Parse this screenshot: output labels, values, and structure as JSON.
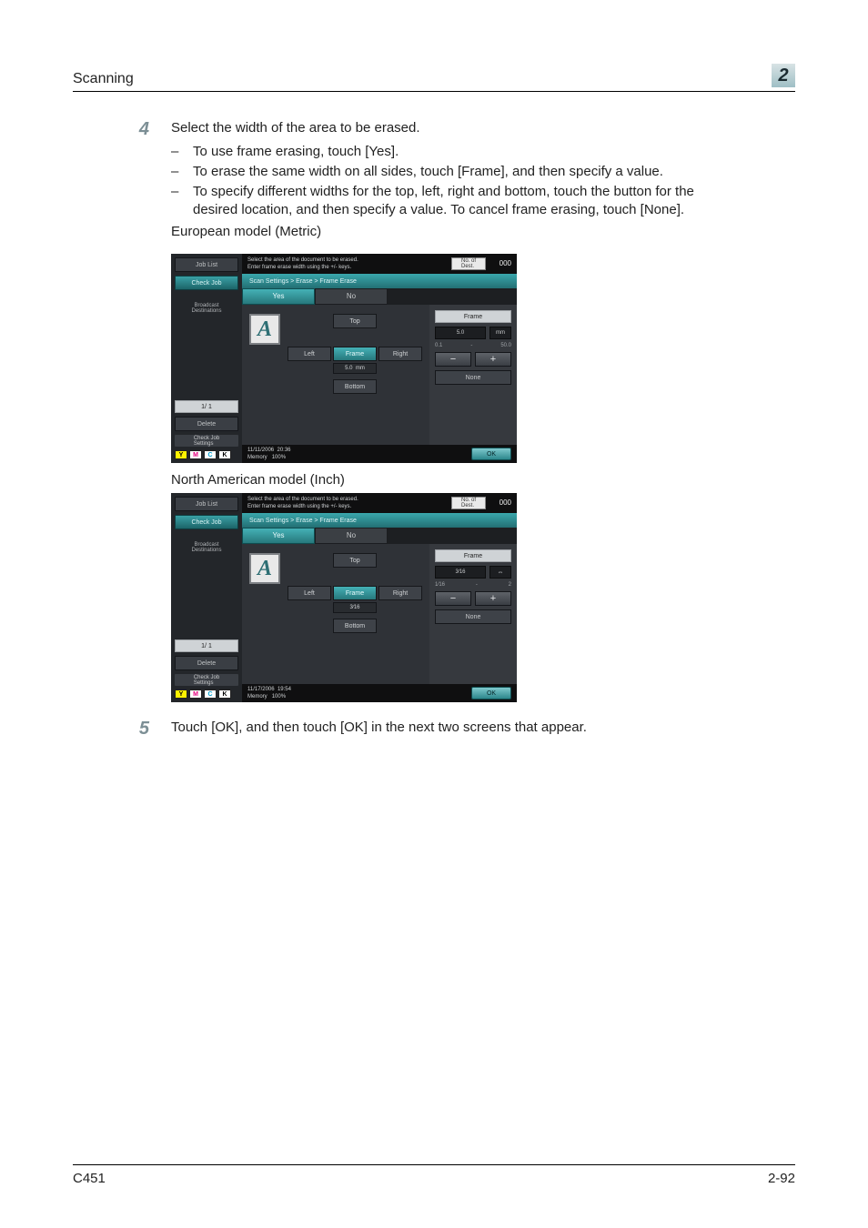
{
  "header": {
    "section": "Scanning",
    "chapter_number": "2"
  },
  "footer": {
    "model": "C451",
    "page": "2-92"
  },
  "steps": [
    {
      "num": "4",
      "text": "Select the width of the area to be erased.",
      "bullets": [
        "To use frame erasing, touch [Yes].",
        "To erase the same width on all sides, touch [Frame], and then specify a value.",
        "To specify different widths for the top, left, right and bottom, touch the button for the desired location, and then specify a value. To cancel frame erasing, touch [None]."
      ],
      "trailing": "European model (Metric)"
    },
    {
      "num": "5",
      "text": "Touch [OK], and then touch [OK] in the next two screens that appear."
    }
  ],
  "na_caption": "North American model (Inch)",
  "device_common": {
    "side": {
      "job_list": "Job List",
      "check_job": "Check Job",
      "broadcast": "Broadcast\nDestinations",
      "pager": "1/   1",
      "delete": "Delete",
      "check_settings": "Check Job\nSettings"
    },
    "flags": {
      "y": "Y",
      "m": "M",
      "c": "C",
      "k": "K"
    },
    "top": {
      "instr_line1": "Select the area of the document to be erased.",
      "instr_line2": "Enter frame erase width using the +/- keys.",
      "readout": "No. of\nDest.",
      "count": "000"
    },
    "crumb": "Scan Settings > Erase > Frame Erase",
    "tabs": {
      "yes": "Yes",
      "no": "No"
    },
    "work": {
      "preview_letter": "A",
      "top": "Top",
      "left": "Left",
      "frame": "Frame",
      "right": "Right",
      "bottom": "Bottom"
    },
    "right_panel": {
      "header": "Frame",
      "minus": "−",
      "plus": "+",
      "none": "None"
    },
    "bottombar": {
      "memory_label": "Memory",
      "memory_pct": "100%",
      "ok": "OK"
    }
  },
  "device_metric": {
    "frame_value": "5.0",
    "frame_unit": "mm",
    "right": {
      "value": "5.0",
      "unit": "mm",
      "range_lo": "0.1",
      "range_sep": "-",
      "range_hi": "50.0"
    },
    "bottombar": {
      "date": "11/11/2006",
      "time": "20:36"
    }
  },
  "device_inch": {
    "frame_value": "3⁄16",
    "right": {
      "value": "3⁄16",
      "swap_icon": "⇔",
      "range_lo": "1⁄16",
      "range_sep": "-",
      "range_hi": "2"
    },
    "bottombar": {
      "date": "11/17/2006",
      "time": "19:54"
    }
  }
}
